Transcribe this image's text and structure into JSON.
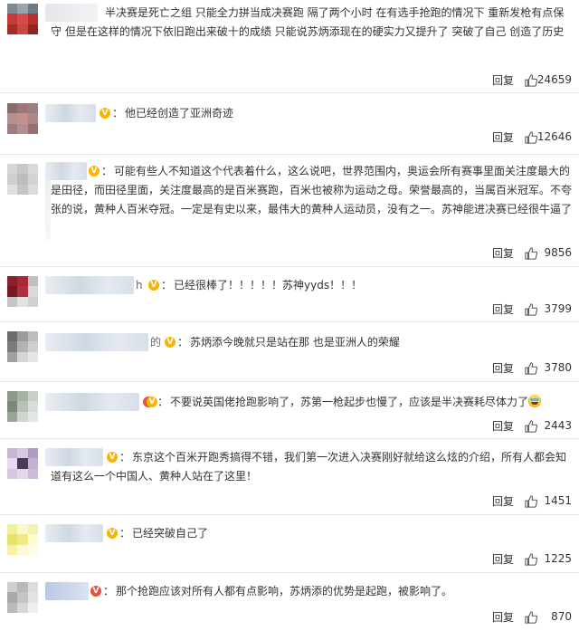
{
  "reply_label": "回复",
  "comments": [
    {
      "handle_suffix": "",
      "text": "半决赛是死亡之组 只能全力拼当成决赛跑 隔了两个小时 在有选手抢跑的情况下 重新发枪有点保守 但是在这样的情况下依旧跑出来破十的成绩 只能说苏炳添现在的硬实力又提升了 突破了自己 创造了历史",
      "likes": "24659"
    },
    {
      "handle_suffix": "",
      "text": "他已经创造了亚洲奇迹",
      "likes": "12646"
    },
    {
      "handle_suffix": "",
      "text": "可能有些人不知道这个代表着什么，这么说吧，世界范围内，奥运会所有赛事里面关注度最大的是田径，而田径里面，关注度最高的是百米赛跑，百米也被称为运动之母。荣誉最高的，当属百米冠军。不夸张的说，黄种人百米夺冠。一定是有史以来，最伟大的黄种人运动员，没有之一。苏神能进决赛已经很牛逼了",
      "likes": "9856"
    },
    {
      "handle_suffix": "h",
      "text": "已经很棒了！！！！！苏神yyds！！！",
      "likes": "3799"
    },
    {
      "handle_suffix": "的",
      "text": "苏炳添今晚就只是站在那 也是亚洲人的荣耀",
      "likes": "3780"
    },
    {
      "handle_suffix": "",
      "text": "不要说英国佬抢跑影响了，苏第一枪起步也慢了，应该是半决赛耗尽体力了",
      "likes": "2443"
    },
    {
      "handle_suffix": "",
      "text": "东京这个百米开跑秀搞得不错，我们第一次进入决赛刚好就给这么炫的介绍，所有人都会知道有这么一个中国人、黄种人站在了这里！",
      "likes": "1451"
    },
    {
      "handle_suffix": "",
      "text": "已经突破自己了",
      "likes": "1225"
    },
    {
      "handle_suffix": "",
      "text": "那个抢跑应该对所有人都有点影响，苏炳添的优势是起跑，被影响了。",
      "likes": "870"
    }
  ]
}
